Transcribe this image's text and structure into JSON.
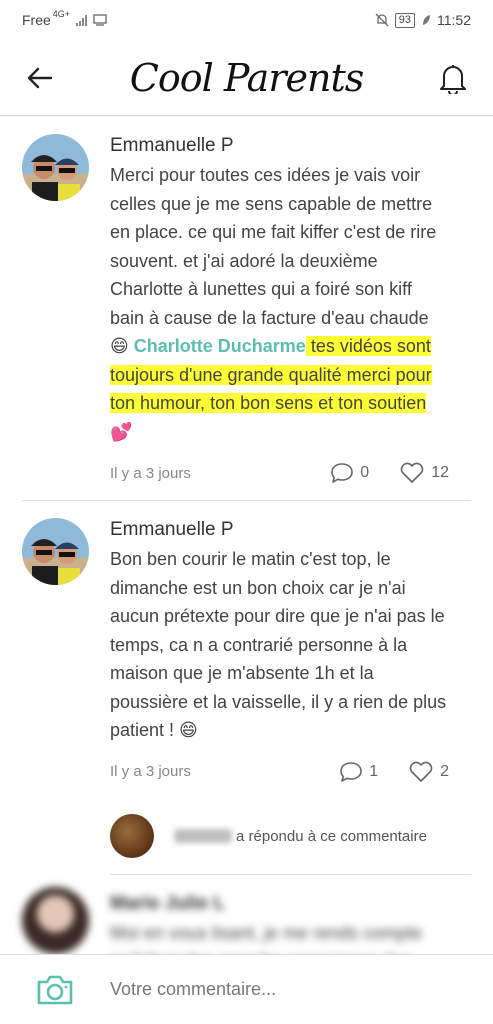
{
  "status_bar": {
    "carrier": "Free",
    "network": "4G+",
    "battery": "93",
    "time": "11:52"
  },
  "header": {
    "logo": "Cool Parents",
    "back_icon": "back-arrow-icon",
    "bell_icon": "bell-icon"
  },
  "comments": [
    {
      "author": "Emmanuelle P",
      "text_1": "Merci pour toutes ces idées je vais voir celles que je me sens capable de mettre en place. ce qui me fait kiffer c'est de rire souvent. et j'ai adoré la deuxième Charlotte à lunettes qui a foiré son kiff bain à cause de la facture d'eau chaude ",
      "emoji_1": "😄",
      "mention": "Charlotte Ducharme",
      "highlight": " tes vidéos sont toujours d'une grande qualité merci pour ton humour, ton bon sens et ton soutien",
      "emoji_2": "💕",
      "time": "Il y a 3 jours",
      "replies": "0",
      "likes": "12"
    },
    {
      "author": "Emmanuelle P",
      "text_1": "Bon ben courir le matin c'est top, le dimanche est un bon choix car je n'ai aucun prétexte pour dire que je n'ai pas le temps, ca n a contrarié personne à la maison que je m'absente 1h et la poussière et la vaisselle, il y a rien de plus patient ! ",
      "emoji_1": "😄",
      "time": "Il y a 3 jours",
      "replies": "1",
      "likes": "2",
      "reply_notice": "a répondu à ce commentaire"
    },
    {
      "author": "Marie Julie L",
      "text_1": "Moi en vous lisant, je me rends compte qu'il faut plus prendre conscience des petits moments de plaisir qu'on a tous les jours, une belle vue, une balade dans les"
    }
  ],
  "composer": {
    "placeholder": "Votre commentaire...",
    "camera_icon": "camera-icon"
  },
  "colors": {
    "mention": "#5bbfb0",
    "highlight": "#ffff36",
    "camera": "#5bbfb0"
  }
}
